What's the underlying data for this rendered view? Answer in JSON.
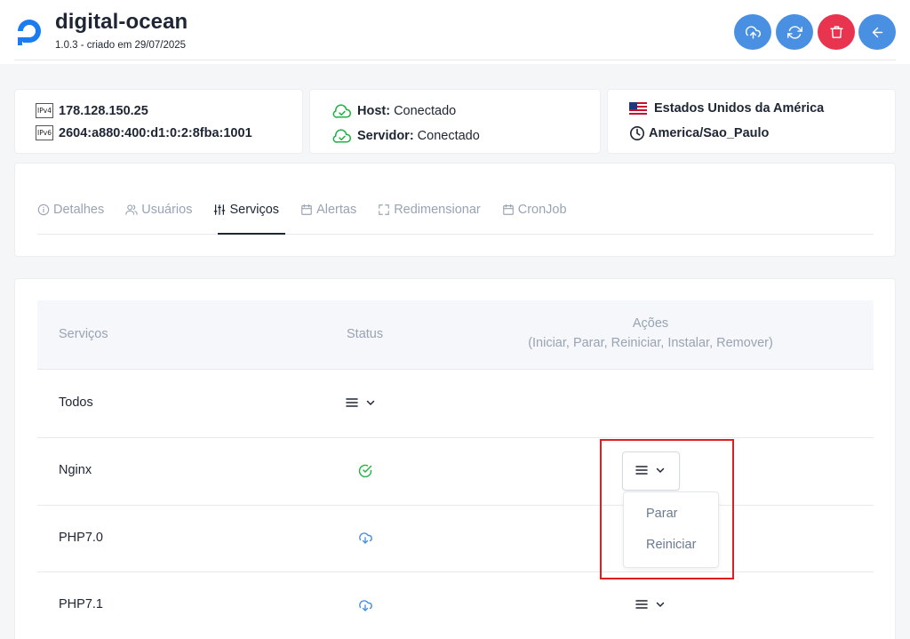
{
  "header": {
    "title": "digital-ocean",
    "subtitle": "1.0.3 - criado em 29/07/2025",
    "buttons": [
      {
        "name": "upload-button",
        "icon": "cloud-upload-icon",
        "color": "#4a90e2"
      },
      {
        "name": "refresh-button",
        "icon": "refresh-icon",
        "color": "#4a90e2"
      },
      {
        "name": "delete-button",
        "icon": "trash-icon",
        "color": "#e8344e"
      },
      {
        "name": "back-button",
        "icon": "arrow-left-icon",
        "color": "#4a90e2"
      }
    ]
  },
  "info": {
    "ipv4_badge": "IPv4",
    "ipv4": "178.128.150.25",
    "ipv6_badge": "IPv6",
    "ipv6": "2604:a880:400:d1:0:2:8fba:1001",
    "host_label": "Host:",
    "host_status": "Conectado",
    "server_label": "Servidor:",
    "server_status": "Conectado",
    "country": "Estados Unidos da América",
    "timezone": "America/Sao_Paulo"
  },
  "tabs": [
    {
      "label": "Detalhes",
      "icon": "info-icon",
      "active": false
    },
    {
      "label": "Usuários",
      "icon": "users-icon",
      "active": false
    },
    {
      "label": "Serviços",
      "icon": "sliders-icon",
      "active": true
    },
    {
      "label": "Alertas",
      "icon": "calendar-icon",
      "active": false
    },
    {
      "label": "Redimensionar",
      "icon": "resize-icon",
      "active": false
    },
    {
      "label": "CronJob",
      "icon": "calendar-icon",
      "active": false
    }
  ],
  "table": {
    "headers": {
      "services": "Serviços",
      "status": "Status",
      "actions": "Ações",
      "actions_sub": "(Iniciar, Parar, Reiniciar, Instalar, Remover)"
    },
    "rows": [
      {
        "name": "Todos",
        "status": "menu"
      },
      {
        "name": "Nginx",
        "status": "running"
      },
      {
        "name": "PHP7.0",
        "status": "install"
      },
      {
        "name": "PHP7.1",
        "status": "install"
      }
    ]
  },
  "dropdown": {
    "items": [
      "Parar",
      "Reiniciar"
    ]
  },
  "colors": {
    "accent": "#4a90e2",
    "danger": "#e8344e",
    "success": "#1fb141",
    "highlight": "#e01e1e"
  }
}
